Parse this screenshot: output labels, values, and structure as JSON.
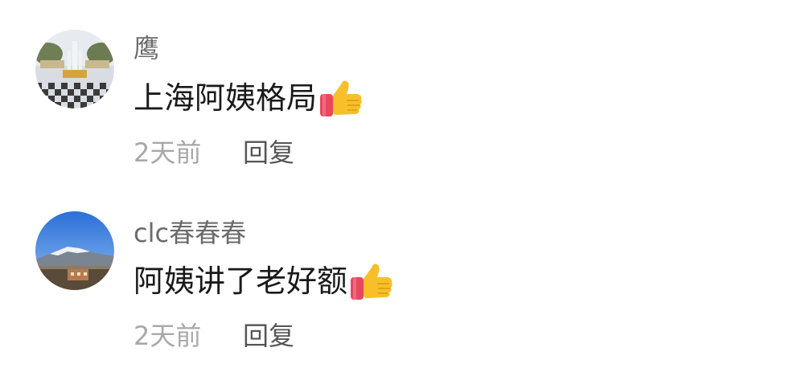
{
  "comments": [
    {
      "username": "鹰",
      "text": "上海阿姨格局",
      "emoji": "thumbs-up-icon",
      "time": "2天前",
      "reply_label": "回复"
    },
    {
      "username": "clc春春春",
      "text": "阿姨讲了老好额",
      "emoji": "thumbs-up-icon",
      "time": "2天前",
      "reply_label": "回复"
    }
  ],
  "colors": {
    "username": "#6b6b6b",
    "text": "#1a1a1a",
    "meta": "#a8a8a8",
    "reply": "#555555",
    "thumb": "#f7c02b",
    "cuff": "#e8475f"
  }
}
